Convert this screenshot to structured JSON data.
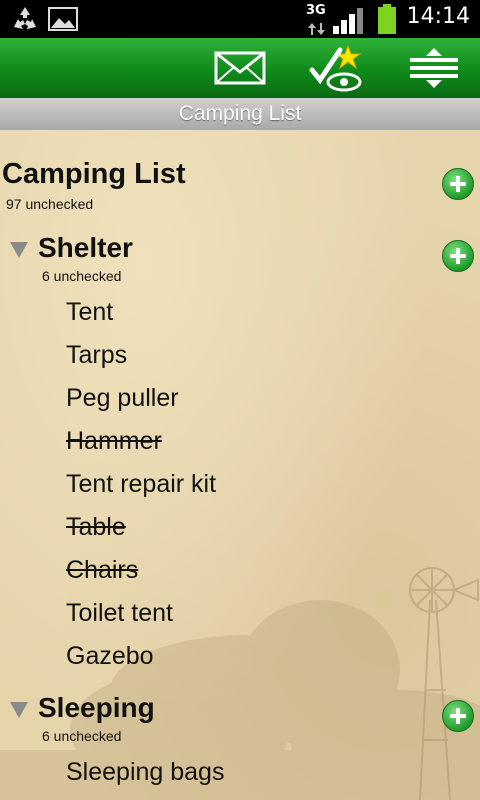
{
  "status_bar": {
    "time": "14:14",
    "network": "3G",
    "icons": [
      "recycle-icon",
      "image-icon",
      "signal-icon",
      "battery-icon"
    ]
  },
  "action_bar": {
    "buttons": [
      "envelope-icon",
      "check-star-eye-icon",
      "expand-collapse-icon"
    ],
    "color": "#1a9a26"
  },
  "title_bar": {
    "title": "Camping List"
  },
  "list": {
    "title": "Camping List",
    "count_text": "97 unchecked",
    "categories": [
      {
        "name": "Shelter",
        "count_text": "6 unchecked",
        "items": [
          {
            "label": "Tent",
            "checked": false
          },
          {
            "label": "Tarps",
            "checked": false
          },
          {
            "label": "Peg puller",
            "checked": false
          },
          {
            "label": "Hammer",
            "checked": true
          },
          {
            "label": "Tent repair kit",
            "checked": false
          },
          {
            "label": "Table",
            "checked": true
          },
          {
            "label": "Chairs",
            "checked": true
          },
          {
            "label": "Toilet tent",
            "checked": false
          },
          {
            "label": "Gazebo",
            "checked": false
          }
        ]
      },
      {
        "name": "Sleeping",
        "count_text": "6 unchecked",
        "items": [
          {
            "label": "Sleeping bags",
            "checked": false
          }
        ]
      }
    ]
  }
}
